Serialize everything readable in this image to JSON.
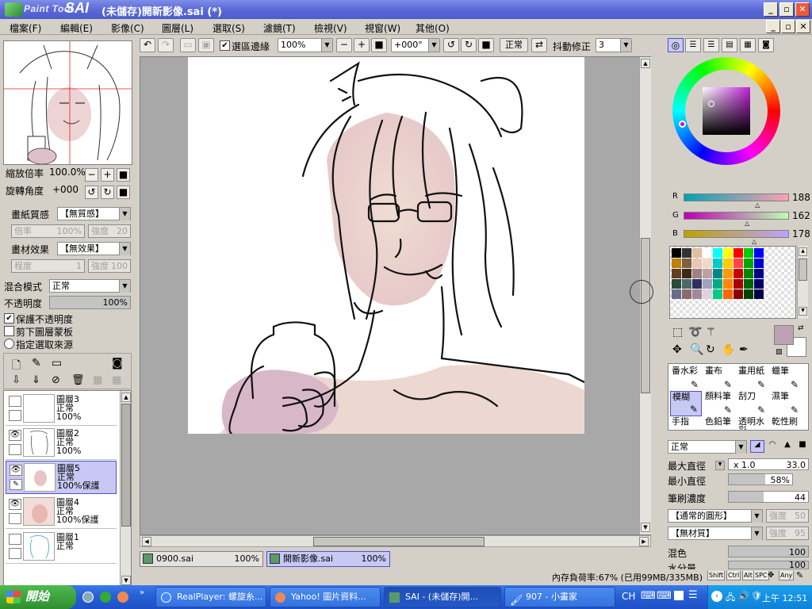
{
  "app": {
    "logo_text": "Paint Tool",
    "logo_brand": "SAI",
    "window_title": "(未儲存)開新影像.sai (*)"
  },
  "menu": [
    "檔案(F)",
    "編輯(E)",
    "影像(C)",
    "圖層(L)",
    "選取(S)",
    "濾鏡(T)",
    "檢視(V)",
    "視窗(W)",
    "其他(O)"
  ],
  "toolbar": {
    "selection_edge_label": "選區邊緣",
    "zoom": "100%",
    "rotation": "+000°",
    "mode": "正常",
    "stabilizer_label": "抖動修正",
    "stabilizer_value": "3"
  },
  "navigator": {
    "zoom_label": "縮放倍率",
    "zoom_value": "100.0%",
    "rotate_label": "旋轉角度",
    "rotate_value": "+000"
  },
  "paper": {
    "texture_label": "畫紙質感",
    "texture_value": "【無質感】",
    "rate_label": "倍率",
    "rate_value": "100%",
    "strength_label": "強度",
    "strength_value": "20",
    "effect_label": "畫材效果",
    "effect_value": "【無效果】",
    "degree_label": "程度",
    "degree_value": "1",
    "strength2_label": "強度",
    "strength2_value": "100"
  },
  "layer_props": {
    "blend_label": "混合模式",
    "blend_value": "正常",
    "opacity_label": "不透明度",
    "opacity_value": "100%",
    "opacity_fraction": 1.0,
    "protect_opacity": "保護不透明度",
    "clip_mask": "剪下圖層蒙板",
    "selection_source": "指定選取來源"
  },
  "layers": [
    {
      "name": "圖層3",
      "mode": "正常",
      "opacity": "100%",
      "visible": false,
      "selected": false
    },
    {
      "name": "圖層2",
      "mode": "正常",
      "opacity": "100%",
      "visible": true,
      "selected": false
    },
    {
      "name": "圖層5",
      "mode": "正常",
      "opacity": "100%保護",
      "visible": true,
      "selected": true
    },
    {
      "name": "圖層4",
      "mode": "正常",
      "opacity": "100%保護",
      "visible": true,
      "selected": false
    },
    {
      "name": "圖層1",
      "mode": "正常",
      "opacity": "",
      "visible": false,
      "selected": false
    }
  ],
  "color": {
    "r_label": "R",
    "r_value": "188",
    "g_label": "G",
    "g_value": "162",
    "b_label": "B",
    "b_value": "178",
    "current": "#bca2b2"
  },
  "brushes": [
    {
      "label": "番水彩",
      "selected": false
    },
    {
      "label": "畫布",
      "selected": false
    },
    {
      "label": "畫用紙",
      "selected": false
    },
    {
      "label": "蠟筆",
      "selected": false
    },
    {
      "label": "模糊",
      "selected": true
    },
    {
      "label": "顏料筆",
      "selected": false
    },
    {
      "label": "刮刀",
      "selected": false
    },
    {
      "label": "濕筆",
      "selected": false
    },
    {
      "label": "手指",
      "selected": false
    },
    {
      "label": "色鉛筆",
      "selected": false
    },
    {
      "label": "透明水彩",
      "selected": false
    },
    {
      "label": "乾性刷",
      "selected": false
    }
  ],
  "brush_settings": {
    "mode": "正常",
    "max_size_label": "最大直徑",
    "max_size_mult": "x 1.0",
    "max_size_value": "33.0",
    "min_size_label": "最小直徑",
    "min_size_value": "58%",
    "min_size_fraction": 0.58,
    "density_label": "筆刷濃度",
    "density_value": "44",
    "density_fraction": 0.44,
    "shape_value": "【通常的圓形】",
    "shape_strength_label": "強度",
    "shape_strength_value": "50",
    "texture_value": "【無材質】",
    "texture_strength_label": "強度",
    "texture_strength_value": "95",
    "blend_label": "混色",
    "blend_value": "100",
    "water_label": "水分量",
    "water_value": "100"
  },
  "doc_tabs": [
    {
      "name": "0900.sai",
      "zoom": "100%",
      "active": false
    },
    {
      "name": "開新影像.sai",
      "zoom": "100%",
      "active": true
    }
  ],
  "status": {
    "memory": "內存負荷率:67% (已用99MB/335MB)",
    "keys": [
      "Shift",
      "Ctrl",
      "Alt",
      "SPC",
      "Any"
    ]
  },
  "taskbar": {
    "start_label": "開始",
    "tasks": [
      {
        "label": "RealPlayer: 螺旋糸...",
        "active": false
      },
      {
        "label": "Yahoo! 圖片資料...",
        "active": false
      },
      {
        "label": "SAI - (未儲存)開...",
        "active": true
      },
      {
        "label": "907 - 小畫家",
        "active": false
      }
    ],
    "lang": "CH",
    "clock": "上午 12:51"
  }
}
